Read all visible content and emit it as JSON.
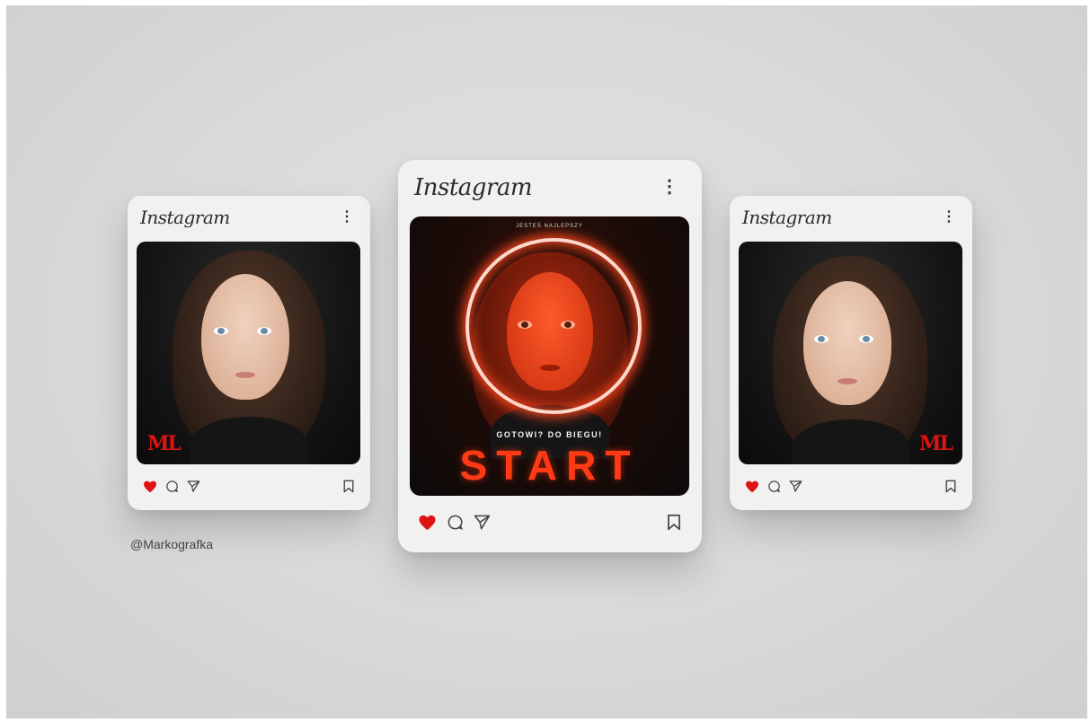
{
  "handle": "@Markografka",
  "brand": "Instagram",
  "menu_glyph": "⋮",
  "colors": {
    "accent_red": "#e01313",
    "neon_red": "#ff3a14",
    "card_bg": "#f1f1f1"
  },
  "cards": [
    {
      "id": "left",
      "brand_label": "Instagram",
      "photo_logo": "ML",
      "icons": [
        "heart-icon",
        "comment-icon",
        "send-icon",
        "bookmark-icon"
      ]
    },
    {
      "id": "center",
      "brand_label": "Instagram",
      "poster": {
        "top_text": "JESTEŚ NAJLEPSZY",
        "sub_text": "GOTOWI? DO BIEGU!",
        "headline": "START"
      },
      "icons": [
        "heart-icon",
        "comment-icon",
        "send-icon",
        "bookmark-icon"
      ]
    },
    {
      "id": "right",
      "brand_label": "Instagram",
      "photo_logo": "ML",
      "icons": [
        "heart-icon",
        "comment-icon",
        "send-icon",
        "bookmark-icon"
      ]
    }
  ]
}
